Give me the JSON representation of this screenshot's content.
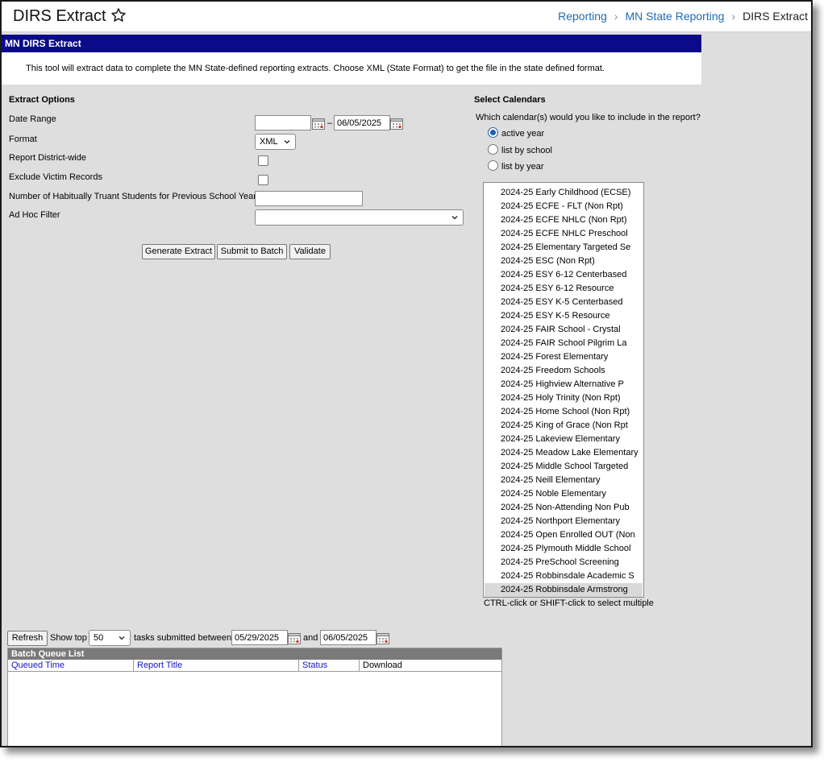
{
  "header": {
    "title": "DIRS Extract",
    "breadcrumb": [
      "Reporting",
      "MN State Reporting",
      "DIRS Extract"
    ]
  },
  "section": {
    "title": "MN DIRS Extract",
    "description": "This tool will extract data to complete the MN State-defined reporting extracts. Choose XML (State Format) to get the file in the state defined format."
  },
  "extract_options": {
    "heading": "Extract Options",
    "date_range_label": "Date Range",
    "date_start": "",
    "date_separator": "–",
    "date_end": "06/05/2025",
    "format_label": "Format",
    "format_value": "XML",
    "district_wide_label": "Report District-wide",
    "exclude_victim_label": "Exclude Victim Records",
    "truant_label": "Number of Habitually Truant Students for Previous School Year",
    "truant_value": "",
    "adhoc_label": "Ad Hoc Filter",
    "adhoc_value": ""
  },
  "buttons": {
    "generate": "Generate Extract",
    "submit_batch": "Submit to Batch",
    "validate": "Validate"
  },
  "calendars": {
    "heading": "Select Calendars",
    "question": "Which calendar(s) would you like to include in the report?",
    "options": [
      "active year",
      "list by school",
      "list by year"
    ],
    "selected_option": "active year",
    "items": [
      "2024-25 Early Childhood (ECSE)",
      "2024-25 ECFE - FLT (Non Rpt)",
      "2024-25 ECFE NHLC (Non Rpt)",
      "2024-25 ECFE NHLC Preschool",
      "2024-25 Elementary Targeted Se",
      "2024-25 ESC (Non Rpt)",
      "2024-25 ESY 6-12 Centerbased",
      "2024-25 ESY 6-12 Resource",
      "2024-25 ESY K-5 Centerbased",
      "2024-25 ESY K-5 Resource",
      "2024-25 FAIR School - Crystal",
      "2024-25 FAIR School Pilgrim La",
      "2024-25 Forest Elementary",
      "2024-25 Freedom Schools",
      "2024-25 Highview Alternative P",
      "2024-25 Holy Trinity (Non Rpt)",
      "2024-25 Home School (Non Rpt)",
      "2024-25 King of Grace (Non Rpt",
      "2024-25 Lakeview Elementary",
      "2024-25 Meadow Lake Elementary",
      "2024-25 Middle School Targeted",
      "2024-25 Neill Elementary",
      "2024-25 Noble Elementary",
      "2024-25 Non-Attending Non Pub",
      "2024-25 Northport Elementary",
      "2024-25 Open Enrolled OUT (Non",
      "2024-25 Plymouth Middle School",
      "2024-25 PreSchool Screening",
      "2024-25 Robbinsdale Academic S",
      "2024-25 Robbinsdale Armstrong"
    ],
    "selected_item": "2024-25 Robbinsdale Armstrong",
    "hint": "CTRL-click or SHIFT-click to select multiple"
  },
  "batch": {
    "refresh_label": "Refresh",
    "show_top_label": "Show top",
    "show_top_value": "50",
    "tasks_label": "tasks submitted between",
    "from_date": "05/29/2025",
    "and_label": "and",
    "to_date": "06/05/2025",
    "list_title": "Batch Queue List",
    "columns": [
      "Queued Time",
      "Report Title",
      "Status",
      "Download"
    ]
  },
  "colors": {
    "section_bar": "#0a0a8a",
    "link": "#1a6cb5",
    "column_link": "#1414c8",
    "panel_bg": "#dedede"
  }
}
